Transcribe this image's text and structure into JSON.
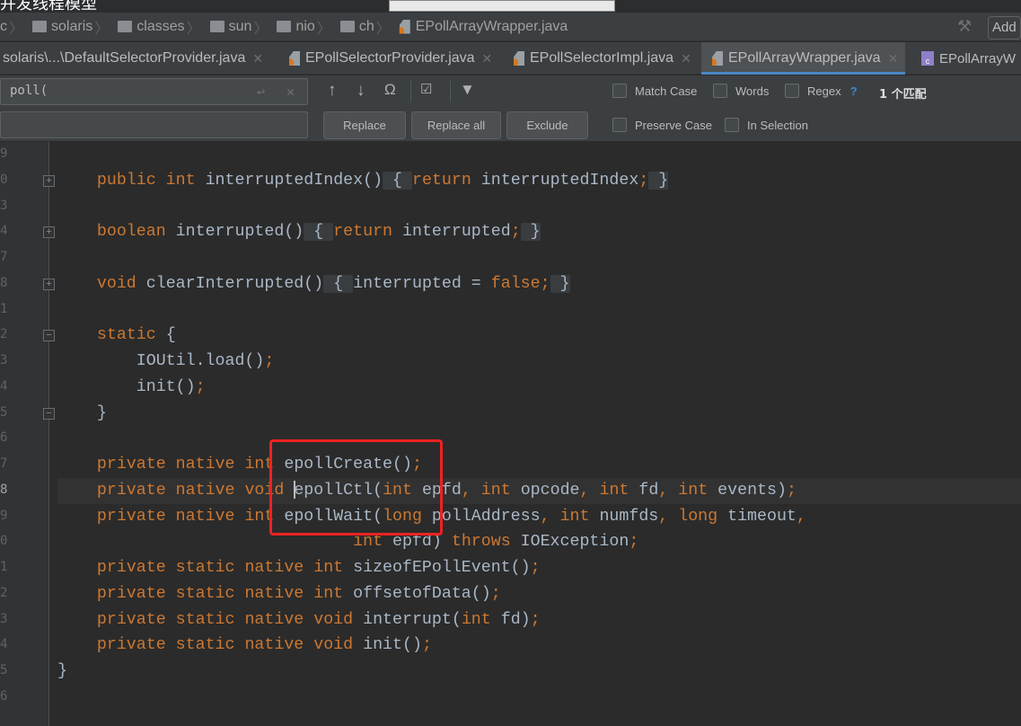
{
  "overlay": {
    "title_fragment": "并发线程模型"
  },
  "breadcrumb": {
    "items": [
      "c",
      "solaris",
      "classes",
      "sun",
      "nio",
      "ch"
    ],
    "file": "EPollArrayWrapper.java"
  },
  "toolbar": {
    "add_label": "Add"
  },
  "tabs": [
    {
      "label": "solaris\\...\\DefaultSelectorProvider.java",
      "icon": "java-file-icon"
    },
    {
      "label": "EPollSelectorProvider.java",
      "icon": "java-file-icon"
    },
    {
      "label": "EPollSelectorImpl.java",
      "icon": "java-file-icon"
    },
    {
      "label": "EPollArrayWrapper.java",
      "icon": "java-file-icon",
      "active": true
    },
    {
      "label": "EPollArrayW",
      "icon": "class-file-icon"
    }
  ],
  "find": {
    "query": "poll(",
    "replace_value": "",
    "replace_label": "Replace",
    "replace_all_label": "Replace all",
    "exclude_label": "Exclude",
    "match_case": "Match Case",
    "words": "Words",
    "regex": "Regex",
    "help": "?",
    "preserve_case": "Preserve Case",
    "in_selection": "In Selection",
    "match_count": "1 个匹配"
  },
  "colors": {
    "keyword": "#cc7832",
    "text": "#a9b7c6",
    "background": "#2b2b2b",
    "accent": "#4a88c7",
    "highlight_box": "#ee2222"
  },
  "editor": {
    "line_numbers": [
      "9",
      "0",
      "3",
      "4",
      "7",
      "8",
      "1",
      "2",
      "3",
      "4",
      "5",
      "6",
      "7",
      "8",
      "9",
      "0",
      "1",
      "2",
      "3",
      "4",
      "5",
      "6"
    ],
    "current_line_index": 13,
    "lines": [
      [],
      [
        [
          "    ",
          ""
        ],
        [
          "public int ",
          "kw"
        ],
        [
          "interruptedIndex()",
          ""
        ],
        [
          " { ",
          "fold-b"
        ],
        [
          "return ",
          "kw"
        ],
        [
          "interruptedIndex",
          ""
        ],
        [
          ";",
          "kw"
        ],
        [
          " }",
          "fold-b"
        ]
      ],
      [],
      [
        [
          "    ",
          ""
        ],
        [
          "boolean ",
          "kw"
        ],
        [
          "interrupted()",
          ""
        ],
        [
          " { ",
          "fold-b"
        ],
        [
          "return ",
          "kw"
        ],
        [
          "interrupted",
          ""
        ],
        [
          ";",
          "kw"
        ],
        [
          " }",
          "fold-b"
        ]
      ],
      [],
      [
        [
          "    ",
          ""
        ],
        [
          "void ",
          "kw"
        ],
        [
          "clearInterrupted()",
          ""
        ],
        [
          " { ",
          "fold-b"
        ],
        [
          "interrupted = ",
          ""
        ],
        [
          "false;",
          "kw"
        ],
        [
          " }",
          "fold-b"
        ]
      ],
      [],
      [
        [
          "    ",
          ""
        ],
        [
          "static ",
          "kw"
        ],
        [
          "{",
          ""
        ]
      ],
      [
        [
          "        IOUtil.load()",
          ""
        ],
        [
          ";",
          "kw"
        ]
      ],
      [
        [
          "        init()",
          ""
        ],
        [
          ";",
          "kw"
        ]
      ],
      [
        [
          "    }",
          ""
        ]
      ],
      [],
      [
        [
          "    ",
          ""
        ],
        [
          "private native int ",
          "kw"
        ],
        [
          "epollCreate()",
          ""
        ],
        [
          ";",
          "kw"
        ]
      ],
      [
        [
          "    ",
          ""
        ],
        [
          "private native void ",
          "kw"
        ],
        [
          "CARET",
          ""
        ],
        [
          "epollCtl(",
          ""
        ],
        [
          "int ",
          "kw"
        ],
        [
          "epfd",
          ""
        ],
        [
          ", ",
          "kw"
        ],
        [
          "int ",
          "kw"
        ],
        [
          "opcode",
          ""
        ],
        [
          ", ",
          "kw"
        ],
        [
          "int ",
          "kw"
        ],
        [
          "fd",
          ""
        ],
        [
          ", ",
          "kw"
        ],
        [
          "int ",
          "kw"
        ],
        [
          "events)",
          ""
        ],
        [
          ";",
          "kw"
        ]
      ],
      [
        [
          "    ",
          ""
        ],
        [
          "private native int ",
          "kw"
        ],
        [
          "epollWait(",
          ""
        ],
        [
          "long ",
          "kw"
        ],
        [
          "pollAddress",
          ""
        ],
        [
          ", ",
          "kw"
        ],
        [
          "int ",
          "kw"
        ],
        [
          "numfds",
          ""
        ],
        [
          ", ",
          "kw"
        ],
        [
          "long ",
          "kw"
        ],
        [
          "timeout",
          ""
        ],
        [
          ",",
          "kw"
        ]
      ],
      [
        [
          "                              ",
          ""
        ],
        [
          "int ",
          "kw"
        ],
        [
          "epfd) ",
          ""
        ],
        [
          "throws ",
          "kw"
        ],
        [
          "IOException",
          ""
        ],
        [
          ";",
          "kw"
        ]
      ],
      [
        [
          "    ",
          ""
        ],
        [
          "private static native int ",
          "kw"
        ],
        [
          "sizeofEPollEvent()",
          ""
        ],
        [
          ";",
          "kw"
        ]
      ],
      [
        [
          "    ",
          ""
        ],
        [
          "private static native int ",
          "kw"
        ],
        [
          "offsetofData()",
          ""
        ],
        [
          ";",
          "kw"
        ]
      ],
      [
        [
          "    ",
          ""
        ],
        [
          "private static native void ",
          "kw"
        ],
        [
          "interrupt(",
          ""
        ],
        [
          "int ",
          "kw"
        ],
        [
          "fd)",
          ""
        ],
        [
          ";",
          "kw"
        ]
      ],
      [
        [
          "    ",
          ""
        ],
        [
          "private static native void ",
          "kw"
        ],
        [
          "init()",
          ""
        ],
        [
          ";",
          "kw"
        ]
      ],
      [
        [
          "}",
          ""
        ]
      ],
      []
    ]
  }
}
